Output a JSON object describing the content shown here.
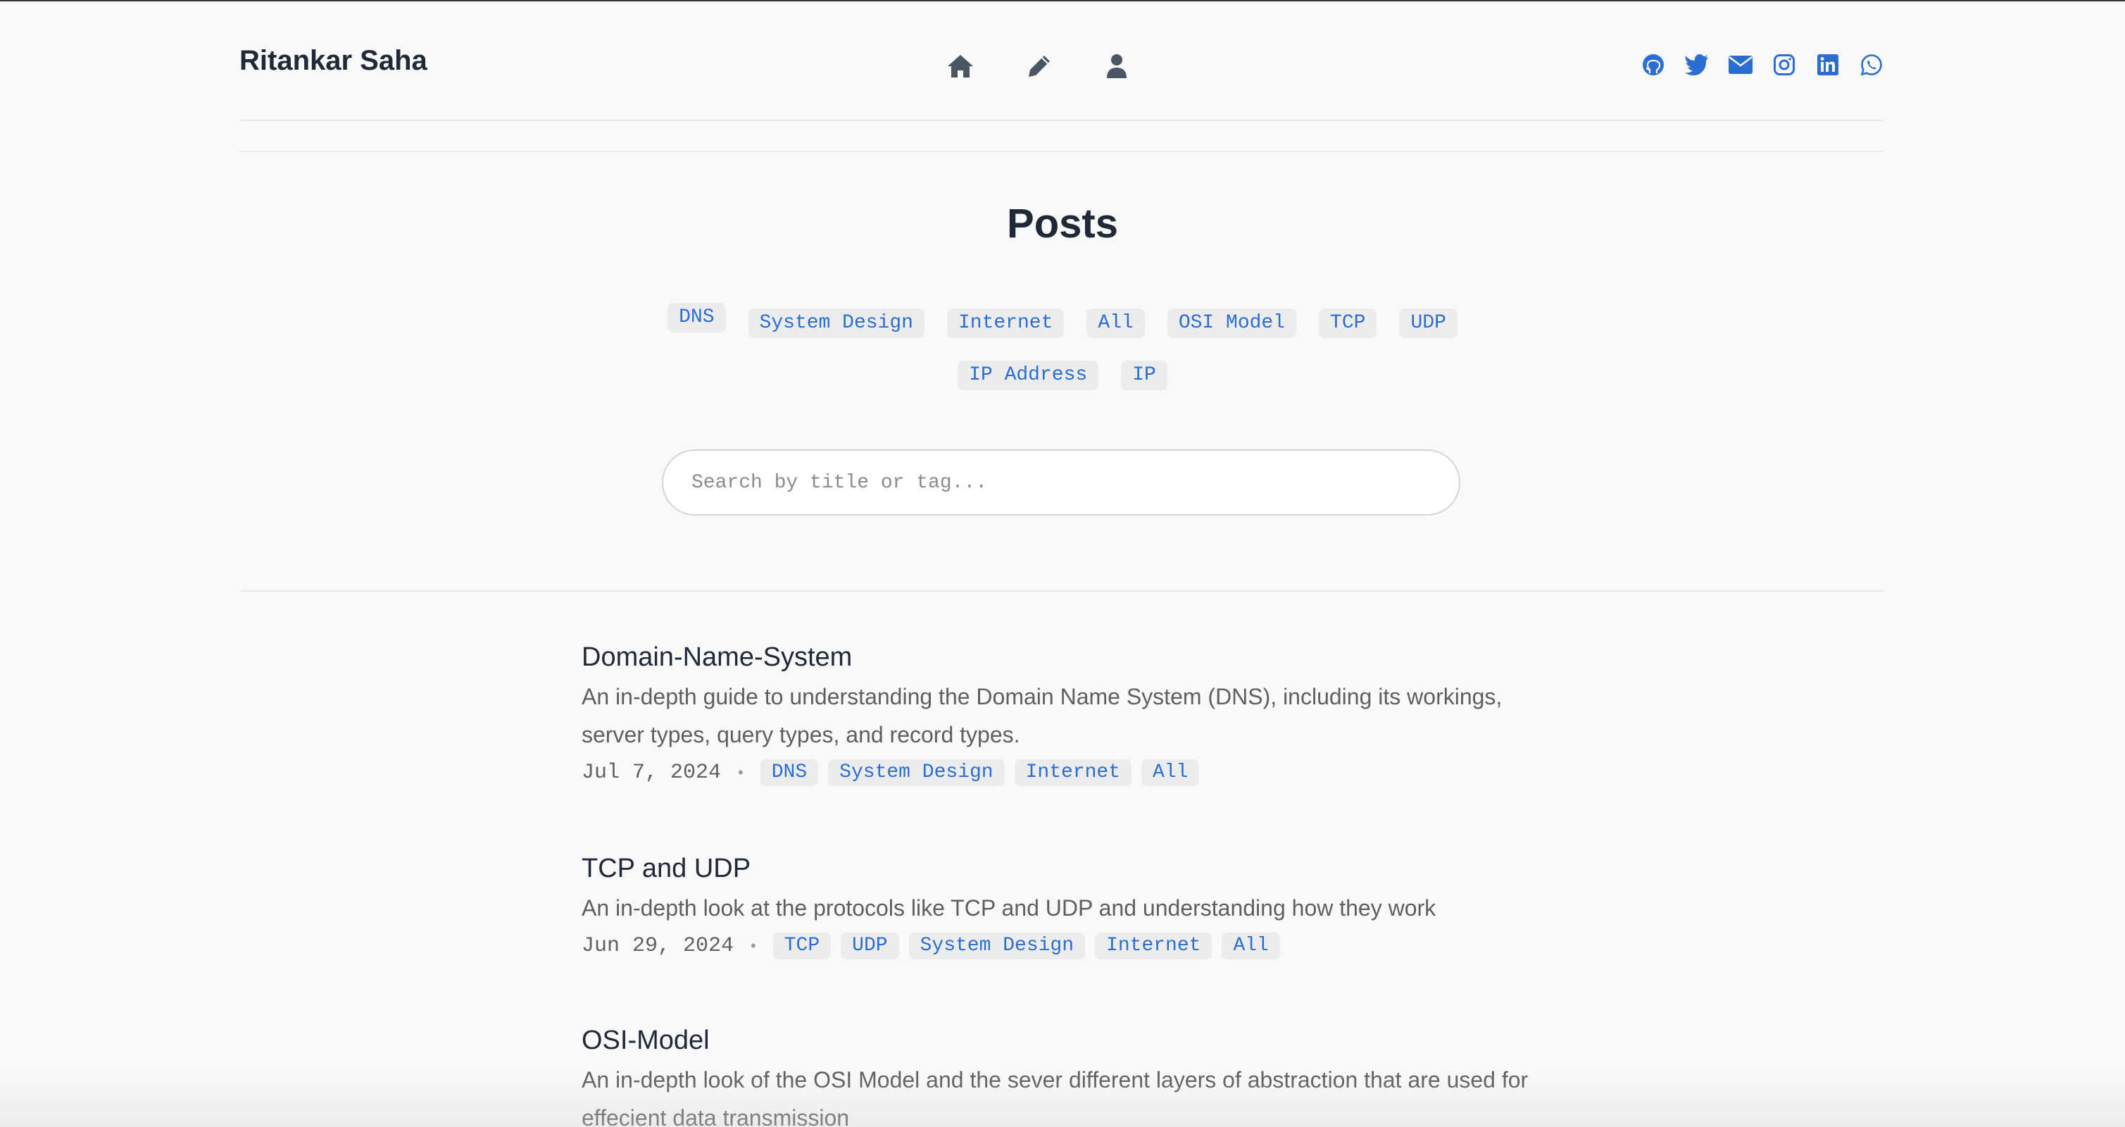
{
  "header": {
    "site_title": "Ritankar Saha",
    "nav": [
      {
        "icon": "home-icon"
      },
      {
        "icon": "pencil-icon"
      },
      {
        "icon": "user-icon"
      }
    ],
    "social": [
      {
        "icon": "github-icon"
      },
      {
        "icon": "twitter-icon"
      },
      {
        "icon": "email-icon"
      },
      {
        "icon": "instagram-icon"
      },
      {
        "icon": "linkedin-icon"
      },
      {
        "icon": "whatsapp-icon"
      }
    ],
    "accent_color": "#2a6ed4"
  },
  "page": {
    "title": "Posts",
    "tags_row1": [
      "DNS",
      "System Design",
      "Internet",
      "All",
      "OSI Model",
      "TCP",
      "UDP"
    ],
    "tags_row2": [
      "IP Address",
      "IP"
    ],
    "search_placeholder": "Search by title or tag..."
  },
  "posts": [
    {
      "title": "Domain-Name-System",
      "description": "An in-depth guide to understanding the Domain Name System (DNS), including its workings, server types, query types, and record types.",
      "date": "Jul 7, 2024",
      "tags": [
        "DNS",
        "System Design",
        "Internet",
        "All"
      ]
    },
    {
      "title": "TCP and UDP",
      "description": "An in-depth look at the protocols like TCP and UDP and understanding how they work",
      "date": "Jun 29, 2024",
      "tags": [
        "TCP",
        "UDP",
        "System Design",
        "Internet",
        "All"
      ]
    },
    {
      "title": "OSI-Model",
      "description": "An in-depth look of the OSI Model and the sever different layers of abstraction that are used for effecient data transmission",
      "date": "",
      "tags": []
    }
  ],
  "meta_separator": "•"
}
